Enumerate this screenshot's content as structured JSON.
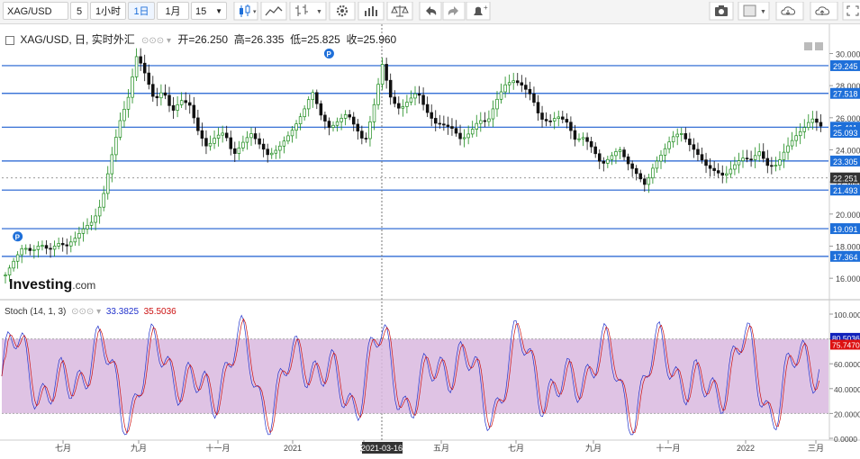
{
  "toolbar": {
    "symbol": "XAG/USD",
    "intervals": [
      "5",
      "1小时",
      "1日",
      "1月",
      "15"
    ],
    "active_interval": "1日"
  },
  "legend": {
    "title": "XAG/USD, 日, 实时外汇",
    "open": "开=26.250",
    "high": "高=26.335",
    "low": "低=25.825",
    "close": "收=25.960"
  },
  "stoch": {
    "label": "Stoch (14, 1, 3)",
    "k": "33.3825",
    "d": "35.5036",
    "k_color": "#2233cc",
    "d_color": "#cc1111",
    "band_upper": 80,
    "band_lower": 20,
    "band_color": "#d9b8df",
    "last_k": "80.5036",
    "last_d": "75.7470"
  },
  "brand": {
    "name": "Investing",
    "suffix": ".com"
  },
  "chart_data": {
    "type": "line",
    "price_axis": [
      "30.000",
      "28.000",
      "26.000",
      "24.000",
      "22.000",
      "20.000",
      "18.000",
      "16.000"
    ],
    "price_range": [
      15.0,
      30.7
    ],
    "levels": [
      "29.245",
      "27.518",
      "25.411",
      "23.305",
      "21.493",
      "19.091",
      "17.364"
    ],
    "last_price": "25.093",
    "crosshair_price": "22.251",
    "stoch_axis": [
      "100.0000",
      "80.0000",
      "60.0000",
      "40.0000",
      "20.0000",
      "0.0000"
    ],
    "time_axis": [
      "七月",
      "九月",
      "十一月",
      "2021",
      "三",
      "五月",
      "七月",
      "九月",
      "十一月",
      "2022",
      "三月"
    ],
    "crosshair_date": "2021-03-16",
    "pivot_markers": [
      "P",
      "P"
    ],
    "series": [
      {
        "values": [
          16.2,
          17.0,
          17.8,
          17.6,
          18.2,
          17.9,
          18.3,
          18.0,
          18.4,
          19.0,
          19.5,
          20.8,
          23.5,
          25.8,
          27.2,
          29.8,
          28.5,
          27.0,
          27.8,
          26.5,
          27.2,
          26.8,
          25.0,
          24.0,
          24.8,
          25.2,
          23.8,
          24.5,
          25.0,
          24.2,
          23.5,
          24.0,
          24.8,
          25.6,
          26.5,
          27.6,
          26.0,
          25.2,
          25.8,
          26.4,
          25.5,
          24.5,
          26.6,
          29.2,
          27.0,
          26.5,
          27.2,
          27.8,
          26.5,
          25.6,
          25.4,
          25.2,
          24.6,
          25.2,
          26.0,
          25.8,
          27.0,
          27.9,
          28.2,
          28.0,
          27.5,
          26.1,
          25.8,
          26.0,
          25.6,
          24.5,
          24.8,
          24.2,
          23.2,
          23.6,
          24.0,
          23.0,
          22.4,
          21.8,
          23.2,
          24.0,
          24.8,
          25.0,
          24.2,
          23.6,
          23.0,
          22.8,
          22.5,
          23.0,
          23.4,
          23.2,
          23.8,
          23.0,
          23.2,
          24.2,
          24.8,
          25.2,
          25.8,
          25.4
        ]
      }
    ]
  }
}
